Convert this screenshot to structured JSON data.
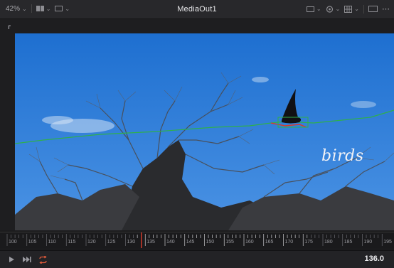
{
  "toolbar": {
    "zoom": "42%",
    "title": "MediaOut1",
    "icons": [
      "viewer-layout-icon",
      "dual-view-icon",
      "roi-icon",
      "color-channel-icon",
      "lut-icon",
      "grid-icon",
      "single-view-icon",
      "more-options-icon"
    ]
  },
  "viewer": {
    "overlay_text": "birds",
    "corner_icon": "viewer-corner-icon"
  },
  "ruler": {
    "ticks": [
      "100",
      "105",
      "110",
      "115",
      "120",
      "125",
      "130",
      "135",
      "140",
      "145",
      "150",
      "155",
      "160",
      "165",
      "170",
      "175",
      "180",
      "185",
      "190",
      "195"
    ],
    "playhead": "134"
  },
  "transport": {
    "buttons": [
      "play-icon",
      "jump-to-end-icon",
      "loop-icon"
    ],
    "timecode": "136.0"
  },
  "colors": {
    "sky": "#2f7ad6",
    "loop_active": "#e05a3a",
    "playhead": "#d83a2a",
    "track": "#2fb04a"
  }
}
